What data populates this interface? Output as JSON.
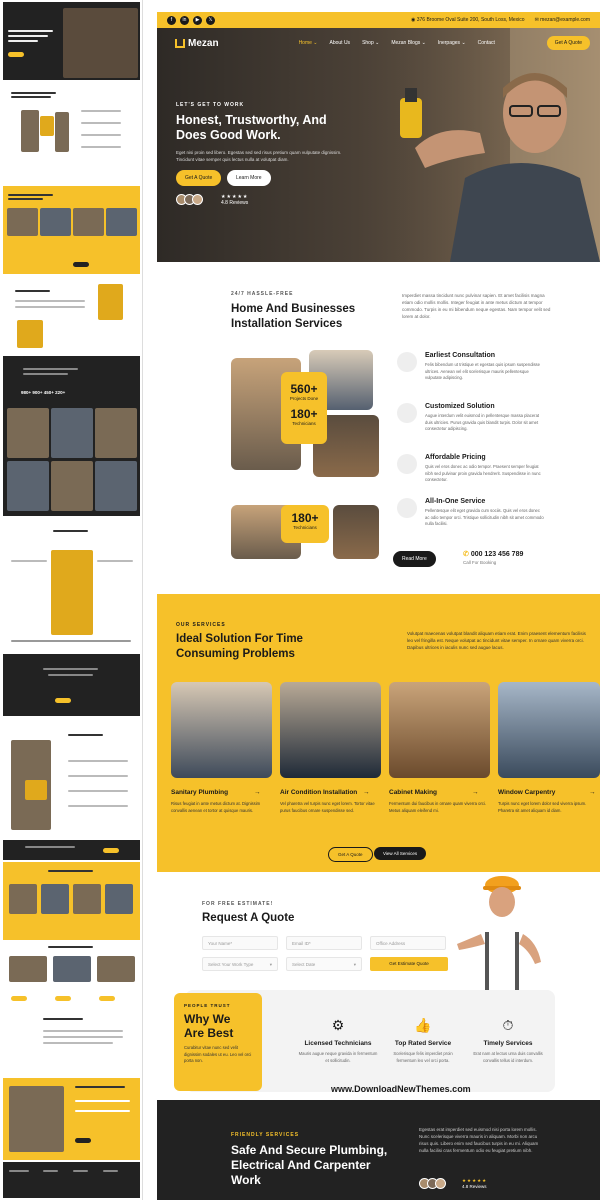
{
  "topbar": {
    "social": [
      "f",
      "in",
      "▶",
      "𝕏"
    ],
    "address": "376 Broome Oval Suite 200, South Loss, Mexico",
    "email": "mezan@example.com"
  },
  "nav": {
    "brand": "Mezan",
    "links": [
      "Home ⌄",
      "About Us",
      "Shop ⌄",
      "Mezan Blogs ⌄",
      "Inerpages ⌄",
      "Contact"
    ],
    "cta": "Get A Quote"
  },
  "hero": {
    "eyebrow": "LET'S GET TO WORK",
    "title": "Honest, Trustworthy, And Does Good Work.",
    "desc": "Eget nisi proin sed libero. Egestas sed sed risus pretium quam vulputate dignissim. Tincidunt vitae semper quis lectus nulla at volutpat diam.",
    "btn_primary": "Get A Quote",
    "btn_secondary": "Learn More",
    "stars": "★★★★★",
    "reviews": "4.8 Reviews"
  },
  "install": {
    "eyebrow": "24/7 HASSLE-FREE",
    "title": "Home And Businesses Installation Services",
    "desc": "Imperdiet massa tincidunt nunc pulvinar sapien. Et amet facilisis magna etiam odio mollis mollis. Integer feugiat in ante metus dictum at tempor commodo. Turpis in eu mi bibendum neque egestas. Nam tempor velit sed lorem at dolor.",
    "stat1_num": "560+",
    "stat1_label": "Projects Done",
    "stat2_num": "180+",
    "stat2_label": "Technicians",
    "stat3_num": "180+",
    "stat3_label": "Technicians",
    "features": [
      {
        "title": "Earliest Consultation",
        "desc": "Felis bibendum ut tristique et egestas quis ipsum suspendisse ultrices. Aenean vel elit scelerisque mauris pellentesque vulputate adipiscing."
      },
      {
        "title": "Customized Solution",
        "desc": "Augue interdum velit euismod in pellentesque massa placerat duis ultricies. Purus gravida quis blandit turpis. Dolor sit amet consectetur adipiscing."
      },
      {
        "title": "Affordable Pricing",
        "desc": "Quis vel eros donec ac odio tempor. Praesent semper feugiat nibh sed pulvinar proin gravida hendrerit. Suspendisse in nunc consectetur."
      },
      {
        "title": "All-In-One Service",
        "desc": "Pellentesque elit eget gravida cum sociis. Quis vel eros donec ac odio tempor orci. Tristique sollicitudin nibh sit amet commodo nulla facilisi."
      }
    ],
    "readmore": "Read More",
    "phone": "000 123 456 789",
    "phone_label": "Call For Booking"
  },
  "services": {
    "eyebrow": "OUR SERVICES",
    "title": "Ideal Solution For Time Consuming Problems",
    "desc": "Volutpat maecenas volutpat blandit aliquam etiam erat. Enim praesent elementum facilisis leo vel fringilla est. Neque volutpat ac tincidunt vitae semper. In ornare quam viverra orci. Dapibus ultrices in iaculis nunc sed augue lacus.",
    "items": [
      {
        "name": "Sanitary Plumbing",
        "desc": "Risus feugiat in ante metus dictum at. Dignissim convallis aenean et tortor at quisque mauris."
      },
      {
        "name": "Air Condition Installation",
        "desc": "Vel pharetra vel turpis nunc eget lorem. Tortor vitae purus faucibus ornare suspendisse sed."
      },
      {
        "name": "Cabinet Making",
        "desc": "Fermentum dui faucibus in ornare quam viverra orci. Metus aliquam eleifend mi."
      },
      {
        "name": "Window Carpentry",
        "desc": "Turpis nunc eget lorem dolor sed viverra ipsum. Pharetra sit amet aliquam id diam."
      }
    ],
    "btn_quote": "Get A Quote",
    "btn_all": "View All Services"
  },
  "quote": {
    "eyebrow": "FOR FREE ESTIMATE!",
    "title": "Request A Quote",
    "name_ph": "Your Name*",
    "email_ph": "Email ID*",
    "address_ph": "Office Address",
    "work_ph": "Select Your Work Type",
    "date_ph": "Select Date",
    "submit": "Get Estimate Quote"
  },
  "why": {
    "eyebrow": "PEOPLE TRUST",
    "title": "Why We Are Best",
    "desc": "Curabitur vitae nunc sed velit dignissim sodales ut eu. Leo vel orci porta non.",
    "features": [
      {
        "icon": "⚙",
        "title": "Licensed Technicians",
        "desc": "Mauris augue neque gravida in fermentum et sollicitudin."
      },
      {
        "icon": "👍",
        "title": "Top Rated Service",
        "desc": "Scelerisque felis imperdiet proin fermentum leo vel orci porta."
      },
      {
        "icon": "⏱",
        "title": "Timely Services",
        "desc": "Erat nam at lectus urna duis convallis convallis tellus id interdum."
      }
    ]
  },
  "watermark": "www.DownloadNewThemes.com",
  "friendly": {
    "eyebrow": "FRIENDLY SERVICES",
    "title": "Safe And Secure Plumbing, Electrical And Carpenter Work",
    "desc": "Egestas erat imperdiet sed euismod nisi porta lorem mollis. Nunc scelerisque viverra mauris in aliquam. Morbi non arcu risus quis. Libero enim sed faucibus turpis in eu mi. Aliquam nulla facilisi cras fermentum odio eu feugiat pretium nibh.",
    "stars": "★★★★★",
    "reviews": "4.8 Reviews"
  },
  "colors": {
    "accent": "#f6c12a",
    "dark": "#222222"
  }
}
